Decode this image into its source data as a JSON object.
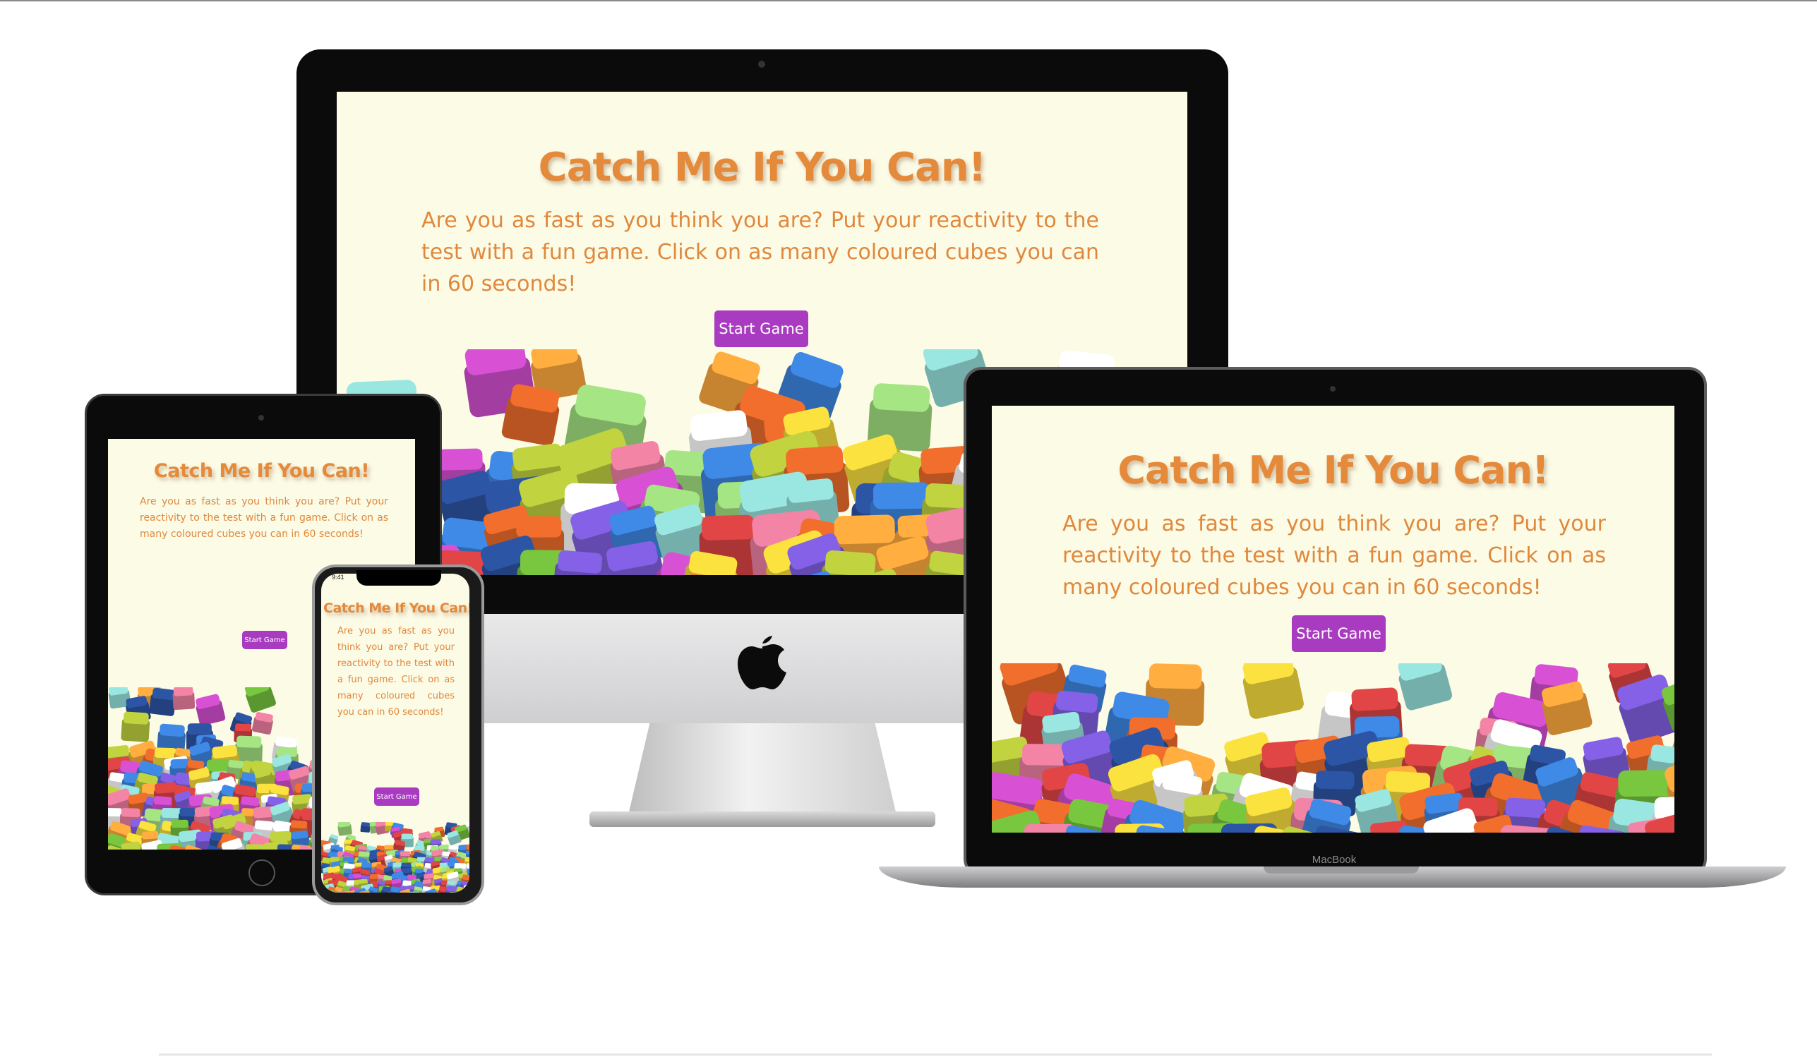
{
  "app": {
    "title": "Catch Me If You Can!",
    "description": "Are you as fast as you think you are? Put your reactivity to the test with a fun game. Click on as many coloured cubes you can in 60 seconds!",
    "start_button": "Start Game"
  },
  "devices": {
    "imac": {
      "name": "iMac"
    },
    "macbook": {
      "name": "MacBook",
      "label": "MacBook"
    },
    "ipad": {
      "name": "iPad"
    },
    "iphone": {
      "name": "iPhone",
      "status_time": "9:41"
    }
  },
  "colors": {
    "page_background": "#fcfbe6",
    "title": "#e48a3a",
    "text": "#e0883c",
    "button": "#a83bbf",
    "button_text": "#ffffff"
  },
  "icons": [
    "apple-logo-icon"
  ]
}
